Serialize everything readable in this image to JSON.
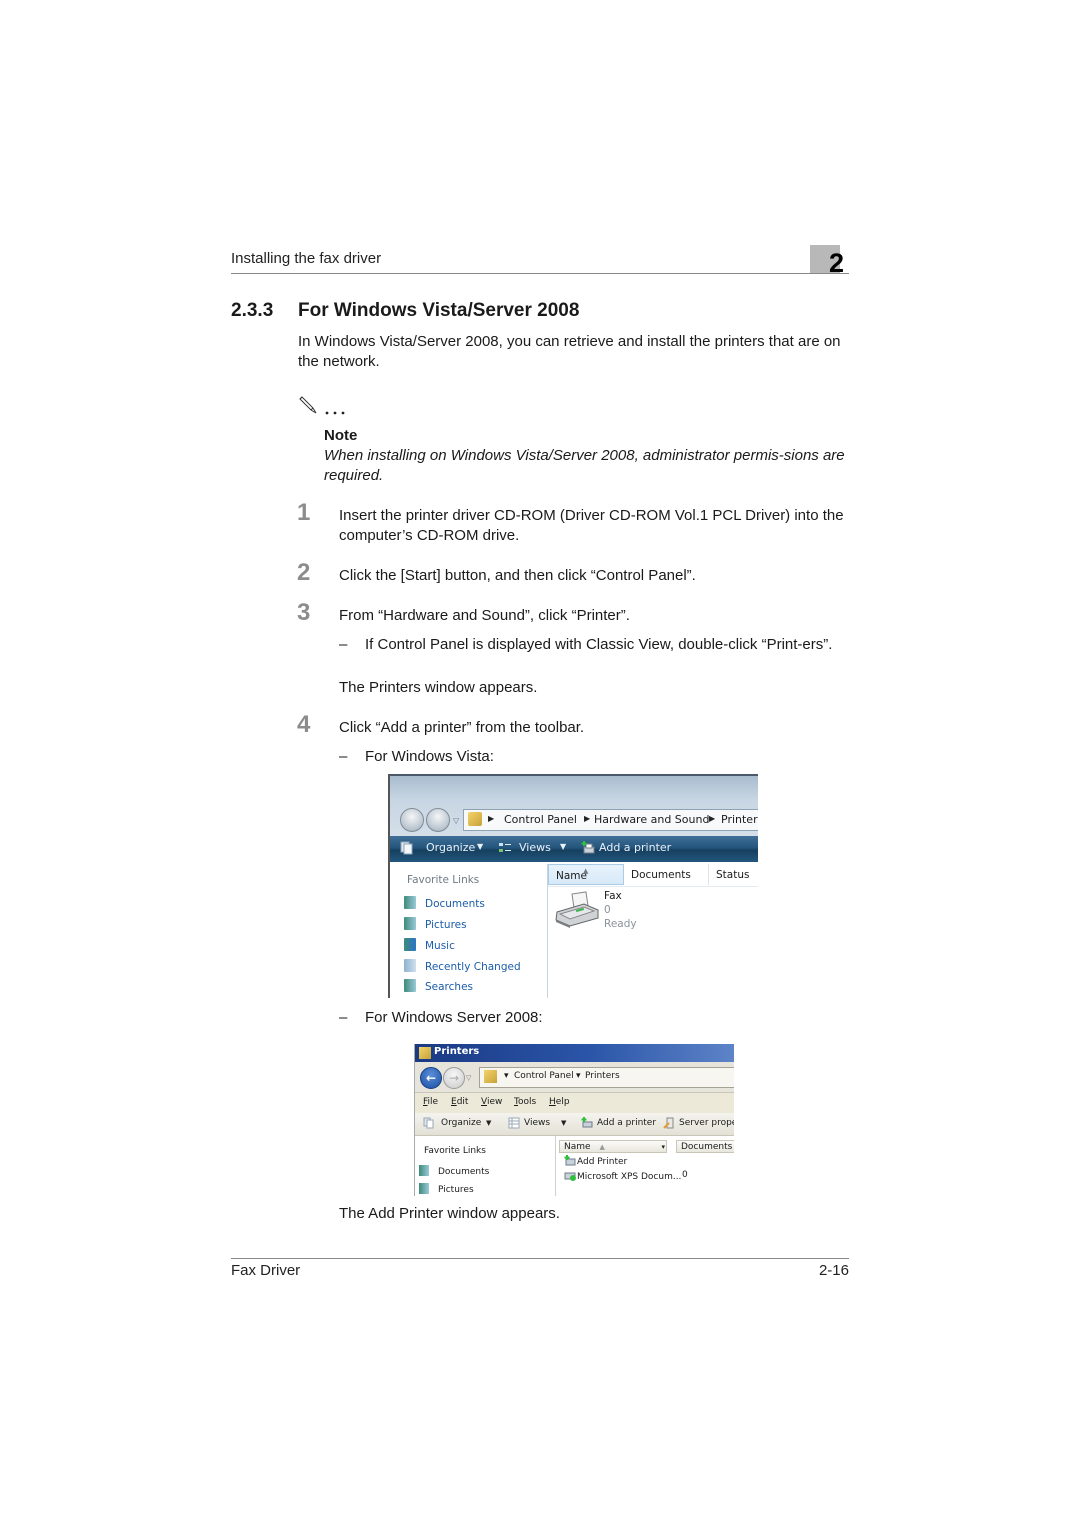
{
  "header": {
    "running_title": "Installing the fax driver",
    "chapter_number": "2"
  },
  "section": {
    "number": "2.3.3",
    "title": "For Windows Vista/Server 2008",
    "intro": "In Windows Vista/Server 2008, you can retrieve and install the printers that are on the network."
  },
  "note": {
    "icon": "pencil-note-icon",
    "label": "Note",
    "text": "When installing on Windows Vista/Server 2008, administrator permis-sions are required."
  },
  "steps": [
    {
      "number": "1",
      "text": "Insert the printer driver CD-ROM (Driver CD-ROM Vol.1 PCL Driver) into the computer’s CD-ROM drive."
    },
    {
      "number": "2",
      "text": "Click the [Start] button, and then click “Control Panel”."
    },
    {
      "number": "3",
      "text": "From “Hardware and Sound”, click “Printer”.",
      "sub": "If Control Panel is displayed with Classic View, double-click “Print-ers”.",
      "result": "The Printers window appears."
    },
    {
      "number": "4",
      "text": "Click “Add a printer” from the toolbar.",
      "sub_vista": "For Windows Vista:",
      "sub_server": "For Windows Server 2008:",
      "result": "The Add Printer window appears."
    }
  ],
  "dash": "–",
  "vista_window": {
    "breadcrumb": [
      "Control Panel",
      "Hardware and Sound",
      "Printers"
    ],
    "toolbar": {
      "organize": "Organize",
      "views": "Views",
      "add_printer": "Add a printer"
    },
    "favorite_links_title": "Favorite Links",
    "favorite_links": [
      "Documents",
      "Pictures",
      "Music",
      "Recently Changed",
      "Searches"
    ],
    "columns": [
      "Name",
      "Documents",
      "Status"
    ],
    "printer": {
      "name": "Fax",
      "documents": "0",
      "status": "Ready"
    }
  },
  "server_window": {
    "title": "Printers",
    "breadcrumb": [
      "Control Panel",
      "Printers"
    ],
    "menu": [
      {
        "key": "F",
        "rest": "ile"
      },
      {
        "key": "E",
        "rest": "dit"
      },
      {
        "key": "V",
        "rest": "iew"
      },
      {
        "key": "T",
        "rest": "ools"
      },
      {
        "key": "H",
        "rest": "elp"
      }
    ],
    "toolbar": {
      "organize": "Organize",
      "views": "Views",
      "add_printer": "Add a printer",
      "server_properties": "Server prope"
    },
    "favorite_links_title": "Favorite Links",
    "favorite_links": [
      "Documents",
      "Pictures"
    ],
    "columns": [
      "Name",
      "Documents"
    ],
    "rows": [
      {
        "name": "Add Printer",
        "documents": ""
      },
      {
        "name": "Microsoft XPS Docum...",
        "documents": "0"
      }
    ]
  },
  "footer": {
    "left": "Fax Driver",
    "page": "2-16"
  },
  "colors": {
    "vista_toolbar": "#24557d",
    "vista_link": "#1a5ca8",
    "server_title": "#1a3a84",
    "step_number": "#8c8c8c"
  }
}
